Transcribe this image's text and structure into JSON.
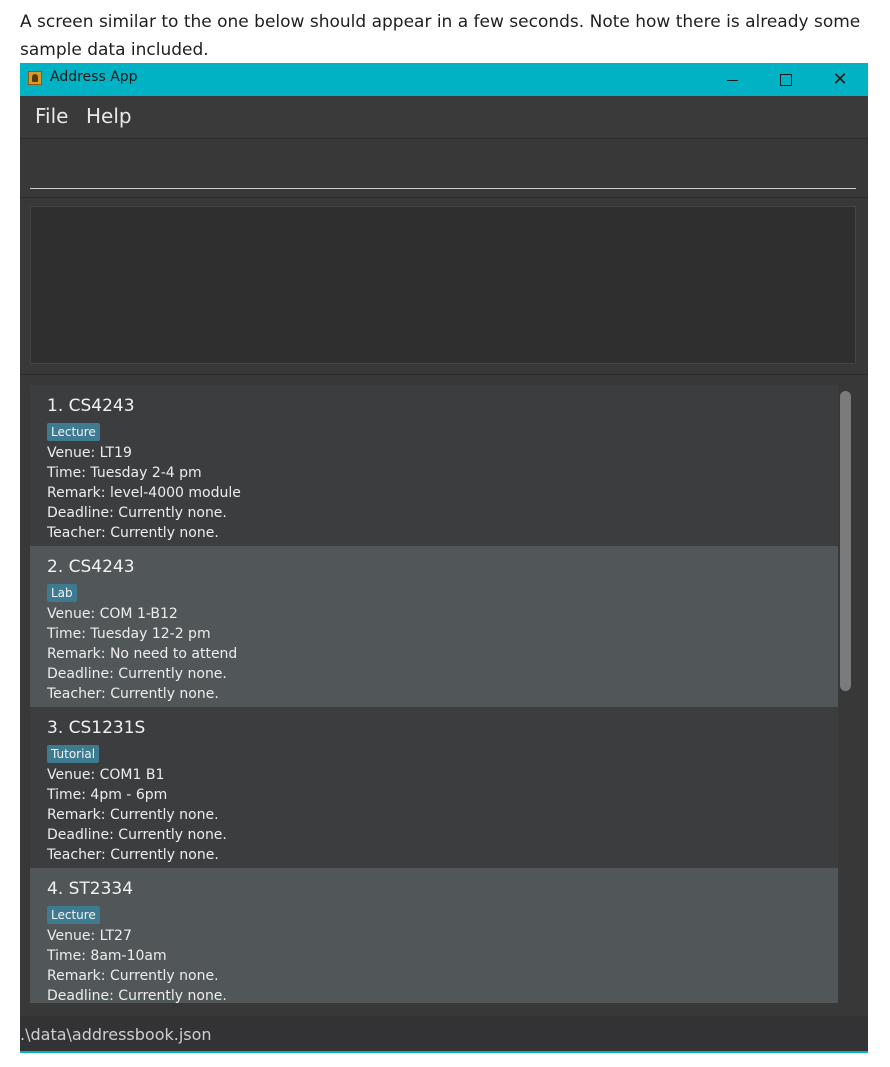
{
  "intro_text": "A screen similar to the one below should appear in a few seconds. Note how there is already some sample data included.",
  "window": {
    "title": "Address App",
    "minimize_icon": "minimize-icon",
    "maximize_icon": "maximize-icon",
    "close_glyph": "✕"
  },
  "menu": {
    "file": "File",
    "help": "Help"
  },
  "command_box": {
    "value": ""
  },
  "result_display": {
    "text": ""
  },
  "cards": [
    {
      "title": "1.  CS4243",
      "tag": "Lecture",
      "venue": "Venue: LT19",
      "time": "Time: Tuesday 2-4 pm",
      "remark": "Remark: level-4000 module",
      "deadline": "Deadline: Currently none.",
      "teacher": "Teacher: Currently none."
    },
    {
      "title": "2.  CS4243",
      "tag": "Lab",
      "venue": "Venue: COM 1-B12",
      "time": "Time: Tuesday 12-2 pm",
      "remark": "Remark: No need to attend",
      "deadline": "Deadline: Currently none.",
      "teacher": "Teacher: Currently none."
    },
    {
      "title": "3.  CS1231S",
      "tag": "Tutorial",
      "venue": "Venue: COM1 B1",
      "time": "Time: 4pm - 6pm",
      "remark": "Remark: Currently none.",
      "deadline": "Deadline: Currently none.",
      "teacher": "Teacher: Currently none."
    },
    {
      "title": "4.  ST2334",
      "tag": "Lecture",
      "venue": "Venue: LT27",
      "time": "Time: 8am-10am",
      "remark": "Remark: Currently none.",
      "deadline": "Deadline: Currently none.",
      "teacher": ""
    }
  ],
  "status_bar": {
    "path": ".\\data\\addressbook.json"
  },
  "colors": {
    "titlebar": "#00b2c3",
    "card_odd": "#3b3d3f",
    "card_even": "#515658",
    "tag": "#3e7b91"
  }
}
